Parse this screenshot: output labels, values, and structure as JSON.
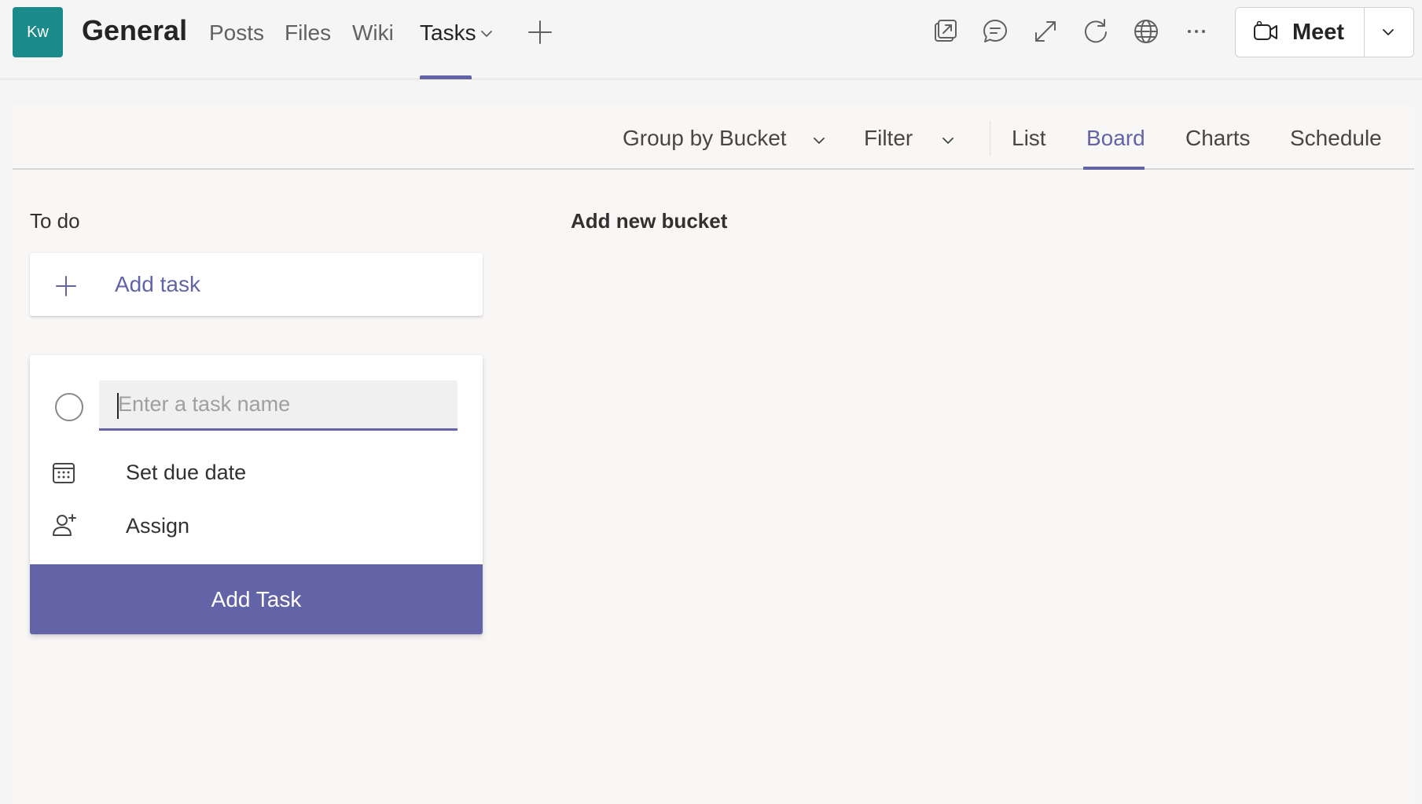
{
  "header": {
    "avatar_initials": "Kw",
    "channel_title": "General",
    "tabs": [
      {
        "label": "Posts"
      },
      {
        "label": "Files"
      },
      {
        "label": "Wiki"
      },
      {
        "label": "Tasks",
        "active": true
      }
    ],
    "icons": [
      "pop-out-icon",
      "conversation-icon",
      "expand-icon",
      "refresh-icon",
      "globe-icon",
      "more-options-icon"
    ],
    "meet": {
      "label": "Meet"
    }
  },
  "toolbar": {
    "group_by_label": "Group by Bucket",
    "filter_label": "Filter",
    "views": [
      {
        "label": "List"
      },
      {
        "label": "Board",
        "active": true
      },
      {
        "label": "Charts"
      },
      {
        "label": "Schedule"
      }
    ]
  },
  "board": {
    "bucket_title": "To do",
    "add_new_bucket": "Add new bucket",
    "add_task_label": "Add task",
    "new_task": {
      "placeholder": "Enter a task name",
      "value": "",
      "due_date_label": "Set due date",
      "assign_label": "Assign",
      "submit_label": "Add Task"
    }
  },
  "colors": {
    "accent": "#6264a7",
    "avatar_bg": "#1a8a8a",
    "background": "#f5f5f5"
  }
}
